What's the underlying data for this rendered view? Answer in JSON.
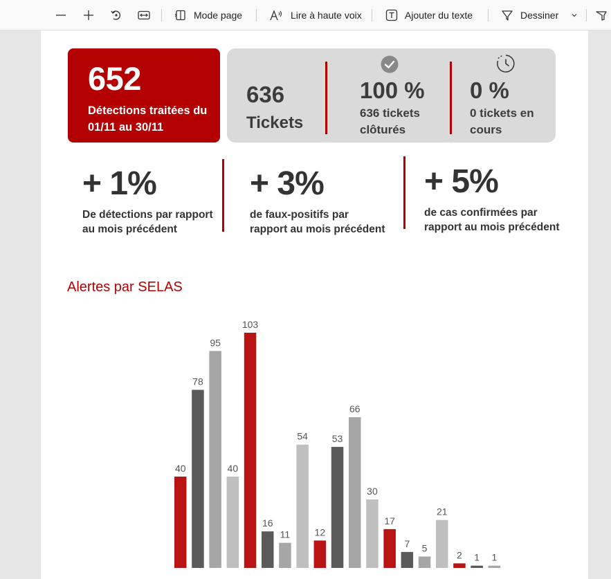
{
  "toolbar": {
    "zoom_out_label": "—",
    "zoom_in_label": "+",
    "mode_page": "Mode page",
    "read_aloud": "Lire à haute voix",
    "add_text": "Ajouter du texte",
    "draw": "Dessiner"
  },
  "summary": {
    "detections_count": "652",
    "detections_label": "Détections traitées du 01/11 au 30/11",
    "tickets_count": "636",
    "tickets_label": "Tickets",
    "closed_pct": "100 %",
    "closed_label": "636 tickets clôturés",
    "open_pct": "0 %",
    "open_label": "0 tickets en cours"
  },
  "stats": [
    {
      "pct": "+ 1%",
      "text": "De détections par rapport au mois précédent"
    },
    {
      "pct": "+ 3%",
      "text": "de faux-positifs par rapport au mois précédent"
    },
    {
      "pct": "+ 5%",
      "text": "de cas confirmées par rapport au mois précédent"
    }
  ],
  "section_title": "Alertes par SELAS",
  "colors": {
    "accent_red": "#b30000",
    "bar_red": "#b81414",
    "bar_dark": "#5a5a5a",
    "bar_mid": "#a6a6a6",
    "bar_light": "#bfbfbf"
  },
  "chart_data": {
    "type": "bar",
    "title": "Alertes par SELAS",
    "values": [
      40,
      78,
      95,
      40,
      103,
      16,
      11,
      54,
      12,
      53,
      66,
      30,
      17,
      7,
      5,
      21,
      2,
      1,
      1
    ],
    "bar_colors": [
      "red",
      "dark",
      "mid",
      "light",
      "red",
      "dark",
      "mid",
      "light",
      "red",
      "dark",
      "mid",
      "light",
      "red",
      "dark",
      "mid",
      "light",
      "red",
      "dark",
      "mid"
    ],
    "ylim": [
      0,
      103
    ],
    "grid": false,
    "legend": "none"
  }
}
